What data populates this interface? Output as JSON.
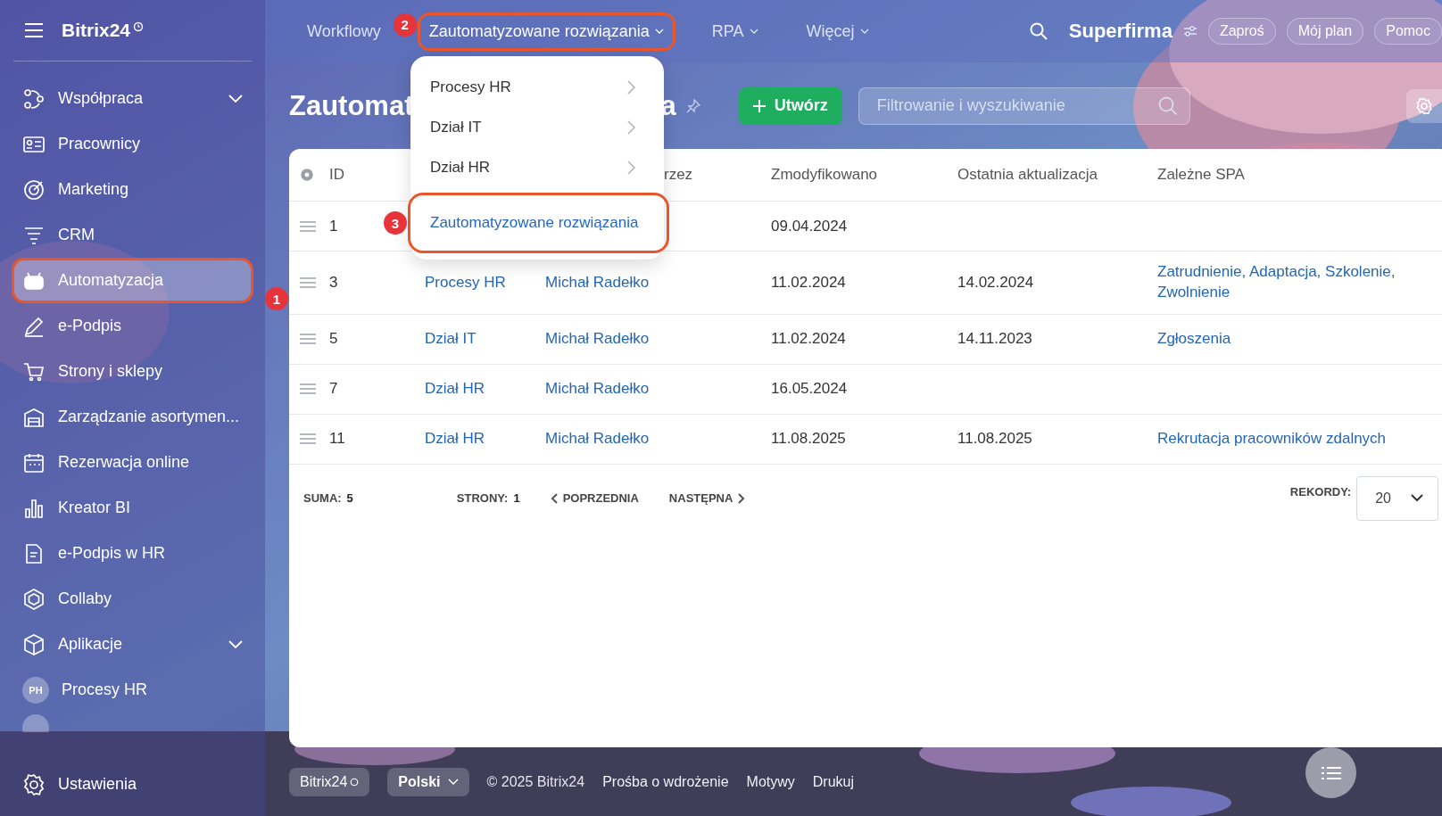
{
  "sidebar": {
    "logo": "Bitrix24",
    "items": [
      {
        "label": "Współpraca",
        "expandable": true,
        "selected": false
      },
      {
        "label": "Pracownicy",
        "expandable": false,
        "selected": false
      },
      {
        "label": "Marketing",
        "expandable": false,
        "selected": false
      },
      {
        "label": "CRM",
        "expandable": false,
        "selected": false
      },
      {
        "label": "Automatyzacja",
        "expandable": false,
        "selected": true,
        "callout": "1"
      },
      {
        "label": "e-Podpis",
        "expandable": false,
        "selected": false
      },
      {
        "label": "Strony i sklepy",
        "expandable": false,
        "selected": false
      },
      {
        "label": "Zarządzanie asortymen...",
        "expandable": false,
        "selected": false
      },
      {
        "label": "Rezerwacja online",
        "expandable": false,
        "selected": false
      },
      {
        "label": "Kreator BI",
        "expandable": false,
        "selected": false
      },
      {
        "label": "e-Podpis w HR",
        "expandable": false,
        "selected": false
      },
      {
        "label": "Collaby",
        "expandable": false,
        "selected": false
      },
      {
        "label": "Aplikacje",
        "expandable": true,
        "selected": false
      },
      {
        "label": "Procesy HR",
        "avatar": "PH",
        "expandable": false,
        "selected": false
      }
    ],
    "settings": "Ustawienia"
  },
  "top_nav": [
    {
      "label": "Workflowy",
      "has_menu": false,
      "selected": false
    },
    {
      "label": "Zautomatyzowane rozwiązania",
      "has_menu": true,
      "selected": true,
      "callout": "2"
    },
    {
      "label": "RPA",
      "has_menu": true,
      "selected": false
    },
    {
      "label": "Więcej",
      "has_menu": true,
      "selected": false
    }
  ],
  "header": {
    "company": "Superfirma",
    "buttons": [
      "Zaproś",
      "Mój plan",
      "Pomoc"
    ]
  },
  "dropdown": [
    {
      "label": "Procesy HR",
      "kind": "submenu"
    },
    {
      "label": "Dział IT",
      "kind": "submenu"
    },
    {
      "label": "Dział HR",
      "kind": "submenu"
    },
    {
      "label": "Zautomatyzowane rozwiązania",
      "kind": "link",
      "callout": "3"
    }
  ],
  "page": {
    "title_parts": [
      "Zautomat",
      "a"
    ],
    "create_button": "Utwórz",
    "search": {
      "placeholder": "Filtrowanie i wyszukiwanie"
    }
  },
  "table": {
    "columns": {
      "id": "ID",
      "created_by": "rzez",
      "modified": "Zmodyfikowano",
      "updated": "Ostatnia aktualizacja",
      "spa": "Zależne SPA"
    },
    "rows": [
      {
        "id": "1",
        "modified": "09.04.2024"
      },
      {
        "id": "3",
        "name": "Procesy HR",
        "created_by": "Michał Radełko",
        "modified": "11.02.2024",
        "updated": "14.02.2024",
        "spa": "Zatrudnienie, Adaptacja, Szkolenie, Zwolnienie"
      },
      {
        "id": "5",
        "name": "Dział IT",
        "created_by": "Michał Radełko",
        "modified": "11.02.2024",
        "updated": "14.11.2023",
        "spa": "Zgłoszenia"
      },
      {
        "id": "7",
        "name": "Dział HR",
        "created_by": "Michał Radełko",
        "modified": "16.05.2024"
      },
      {
        "id": "11",
        "name": "Dział HR",
        "created_by": "Michał Radełko",
        "modified": "11.08.2025",
        "updated": "11.08.2025",
        "spa": "Rekrutacja pracowników zdalnych"
      }
    ]
  },
  "pagination": {
    "total_label": "SUMA:",
    "total": "5",
    "pages_label": "STRONY:",
    "pages": "1",
    "prev": "POPRZEDNIA",
    "next": "NASTĘPNA",
    "records_label": "REKORDY:",
    "records": "20"
  },
  "footer": {
    "logo": "Bitrix24",
    "language": "Polski",
    "links": [
      "© 2025 Bitrix24",
      "Prośba o wdrożenie",
      "Motywy",
      "Drukuj"
    ]
  }
}
